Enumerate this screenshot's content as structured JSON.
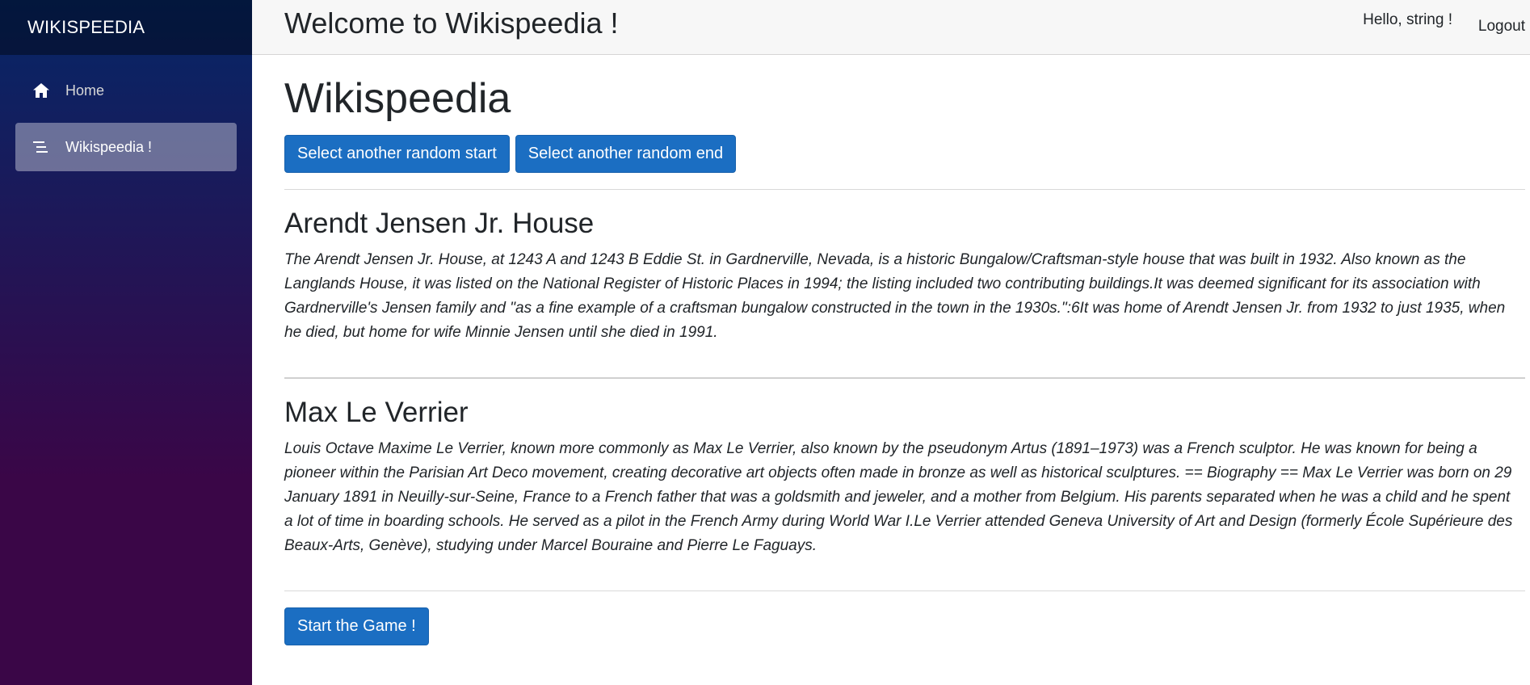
{
  "sidebar": {
    "brand": "WIKISPEEDIA",
    "items": [
      {
        "label": "Home",
        "icon": "home-icon"
      },
      {
        "label": "Wikispeedia !",
        "icon": "menu-lines-icon"
      }
    ]
  },
  "header": {
    "welcome": "Welcome to Wikispeedia !",
    "hello": "Hello, string !",
    "logout": "Logout"
  },
  "main": {
    "title": "Wikispeedia",
    "random_start_label": "Select another random start",
    "random_end_label": "Select another random end",
    "start_article": {
      "title": "Arendt Jensen Jr. House",
      "body": "The Arendt Jensen Jr. House, at 1243 A and 1243 B Eddie St. in Gardnerville, Nevada, is a historic Bungalow/Craftsman-style house that was built in 1932. Also known as the Langlands House, it was listed on the National Register of Historic Places in 1994; the listing included two contributing buildings.It was deemed significant for its association with Gardnerville's Jensen family and \"as a fine example of a craftsman bungalow constructed in the town in the 1930s.\":6It was home of Arendt Jensen Jr. from 1932 to just 1935, when he died, but home for wife Minnie Jensen until she died in 1991."
    },
    "end_article": {
      "title": "Max Le Verrier",
      "body": "Louis Octave Maxime Le Verrier, known more commonly as Max Le Verrier, also known by the pseudonym Artus (1891–1973) was a French sculptor. He was known for being a pioneer within the Parisian Art Deco movement, creating decorative art objects often made in bronze as well as historical sculptures. == Biography == Max Le Verrier was born on 29 January 1891 in Neuilly-sur-Seine, France to a French father that was a goldsmith and jeweler, and a mother from Belgium. His parents separated when he was a child and he spent a lot of time in boarding schools. He served as a pilot in the French Army during World War I.Le Verrier attended Geneva University of Art and Design (formerly École Supérieure des Beaux-Arts, Genève), studying under Marcel Bouraine and Pierre Le Faguays."
    },
    "start_game_label": "Start the Game !"
  },
  "colors": {
    "primary_button": "#1b6ec2",
    "sidebar_top": "#052767",
    "sidebar_bottom": "#3a0647"
  }
}
